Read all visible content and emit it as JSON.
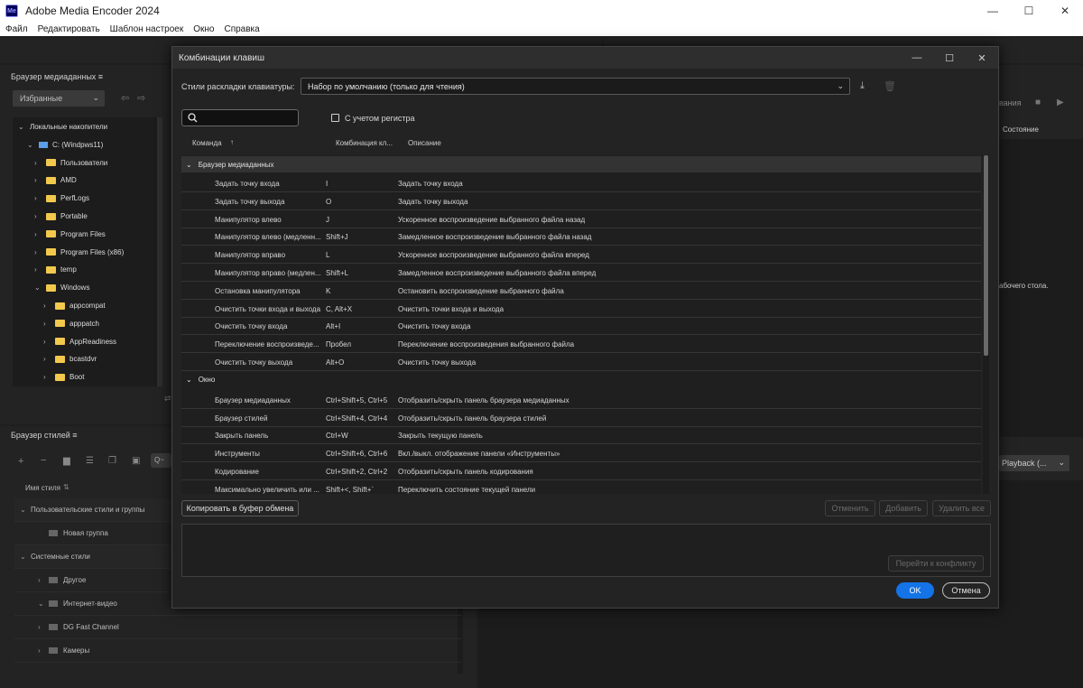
{
  "app": {
    "title": "Adobe Media Encoder 2024",
    "logo": "Me",
    "window_controls": {
      "minimize": "—",
      "maximize": "☐",
      "close": "✕"
    }
  },
  "menu": [
    "Файл",
    "Редактировать",
    "Шаблон настроек",
    "Окно",
    "Справка"
  ],
  "media_browser": {
    "title": "Браузер медиаданных ≡",
    "favorites": "Избранные",
    "tree": [
      {
        "label": "Локальные накопители",
        "level": 0,
        "chev": "⌄",
        "icon": "none"
      },
      {
        "label": "C: (Windpws11)",
        "level": 1,
        "chev": "⌄",
        "icon": "drive"
      },
      {
        "label": "Пользователи",
        "level": 2,
        "chev": "›",
        "icon": "folder"
      },
      {
        "label": "AMD",
        "level": 2,
        "chev": "›",
        "icon": "folder"
      },
      {
        "label": "PerfLogs",
        "level": 2,
        "chev": "›",
        "icon": "folder"
      },
      {
        "label": "Portable",
        "level": 2,
        "chev": "›",
        "icon": "folder"
      },
      {
        "label": "Program Files",
        "level": 2,
        "chev": "›",
        "icon": "folder"
      },
      {
        "label": "Program Files (x86)",
        "level": 2,
        "chev": "›",
        "icon": "folder"
      },
      {
        "label": "temp",
        "level": 2,
        "chev": "›",
        "icon": "folder"
      },
      {
        "label": "Windows",
        "level": 2,
        "chev": "⌄",
        "icon": "folder"
      },
      {
        "label": "appcompat",
        "level": 3,
        "chev": "›",
        "icon": "folder"
      },
      {
        "label": "apppatch",
        "level": 3,
        "chev": "›",
        "icon": "folder"
      },
      {
        "label": "AppReadiness",
        "level": 3,
        "chev": "›",
        "icon": "folder"
      },
      {
        "label": "bcastdvr",
        "level": 3,
        "chev": "›",
        "icon": "folder"
      },
      {
        "label": "Boot",
        "level": 3,
        "chev": "›",
        "icon": "folder"
      }
    ]
  },
  "style_browser": {
    "title": "Браузер стилей ≡",
    "search_placeholder": "Q~",
    "column": "Имя стиля",
    "rows": [
      {
        "label": "Пользовательские стили и группы",
        "chev": "⌄",
        "indent": 0
      },
      {
        "label": "Новая группа",
        "chev": "",
        "indent": 1
      },
      {
        "label": "Системные стили",
        "chev": "⌄",
        "indent": 0
      },
      {
        "label": "Другое",
        "chev": "›",
        "indent": 1
      },
      {
        "label": "Интернет-видео",
        "chev": "⌄",
        "indent": 1
      },
      {
        "label": "DG Fast Channel",
        "chev": "›",
        "indent": 1
      },
      {
        "label": "Камеры",
        "chev": "›",
        "indent": 1
      }
    ]
  },
  "right_panel": {
    "partial_label": "вания",
    "state_column": "Состояние",
    "partial_text": "абочего стола.",
    "playback": "Playback (..."
  },
  "dialog": {
    "title": "Комбинации клавиш",
    "layout_label": "Стили раскладки клавиатуры:",
    "layout_value": "Набор по умолчанию (только для чтения)",
    "case_sensitive": "С учетом регистра",
    "columns": {
      "command": "Команда",
      "shortcut": "Комбинация кл...",
      "description": "Описание"
    },
    "groups": [
      {
        "name": "Браузер медиаданных",
        "rows": [
          {
            "command": "Задать точку входа",
            "shortcut": "I",
            "description": "Задать точку входа"
          },
          {
            "command": "Задать точку выхода",
            "shortcut": "O",
            "description": "Задать точку выхода"
          },
          {
            "command": "Манипулятор влево",
            "shortcut": "J",
            "description": "Ускоренное воспроизведение выбранного файла назад"
          },
          {
            "command": "Манипулятор влево (медленн...",
            "shortcut": "Shift+J",
            "description": "Замедленное воспроизведение выбранного файла назад"
          },
          {
            "command": "Манипулятор вправо",
            "shortcut": "L",
            "description": "Ускоренное воспроизведение выбранного файла вперед"
          },
          {
            "command": "Манипулятор вправо (медлен...",
            "shortcut": "Shift+L",
            "description": "Замедленное воспроизведение выбранного файла вперед"
          },
          {
            "command": "Остановка манипулятора",
            "shortcut": "K",
            "description": "Остановить воспроизведение выбранного файла"
          },
          {
            "command": "Очистить точки входа и выхода",
            "shortcut": "C, Alt+X",
            "description": "Очистить точки входа и выхода"
          },
          {
            "command": "Очистить точку входа",
            "shortcut": "Alt+I",
            "description": "Очистить точку входа"
          },
          {
            "command": "Переключение воспроизведе...",
            "shortcut": "Пробел",
            "description": "Переключение воспроизведения выбранного файла"
          },
          {
            "command": "Очистить точку выхода",
            "shortcut": "Alt+O",
            "description": "Очистить точку выхода"
          }
        ]
      },
      {
        "name": "Окно",
        "rows": [
          {
            "command": "Браузер медиаданных",
            "shortcut": "Ctrl+Shift+5, Ctrl+5",
            "description": "Отобразить/скрыть панель браузера медиаданных"
          },
          {
            "command": "Браузер стилей",
            "shortcut": "Ctrl+Shift+4, Ctrl+4",
            "description": "Отобразить/скрыть панель браузера стилей"
          },
          {
            "command": "Закрыть панель",
            "shortcut": "Ctrl+W",
            "description": "Закрыть текущую панель"
          },
          {
            "command": "Инструменты",
            "shortcut": "Ctrl+Shift+6, Ctrl+6",
            "description": "Вкл./выкл. отображение панели «Инструменты»"
          },
          {
            "command": "Кодирование",
            "shortcut": "Ctrl+Shift+2, Ctrl+2",
            "description": "Отобразить/скрыть панель кодирования"
          },
          {
            "command": "Максимально увеличить или ...",
            "shortcut": "Shift+<, Shift+`",
            "description": "Переключить состояние текущей панели"
          }
        ]
      }
    ],
    "buttons": {
      "copy": "Копировать в буфер обмена",
      "undo": "Отменить",
      "add": "Добавить",
      "delete_all": "Удалить все",
      "goto_conflict": "Перейти к конфликту",
      "ok": "OK",
      "cancel": "Отмена"
    }
  }
}
